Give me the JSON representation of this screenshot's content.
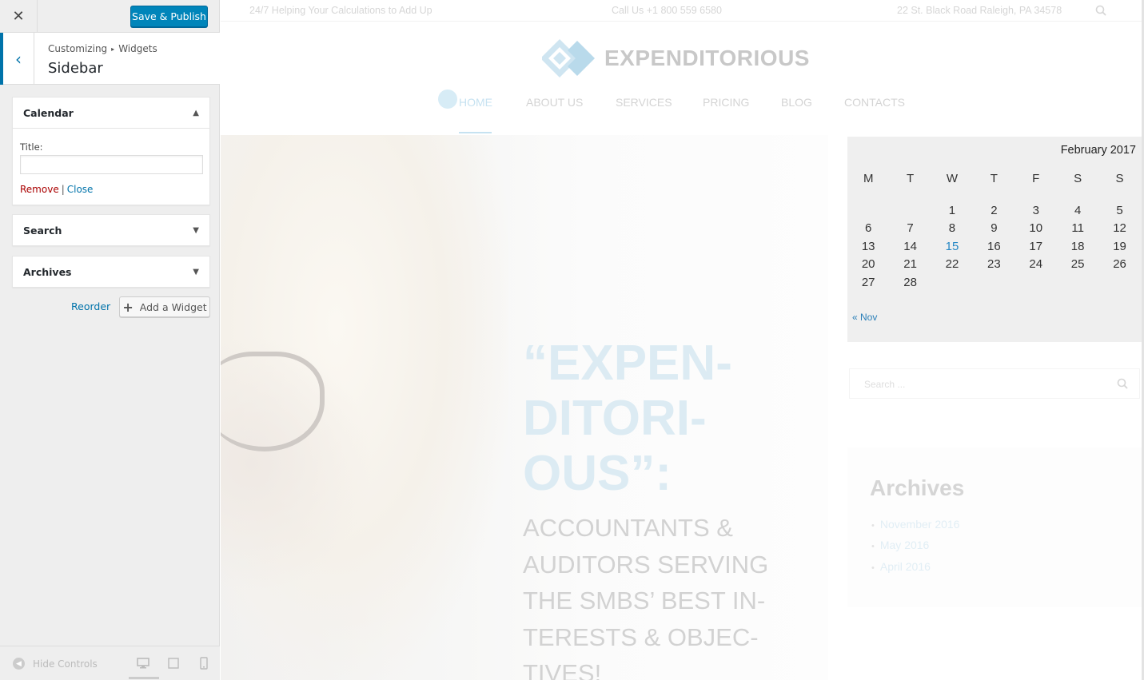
{
  "customizer": {
    "close_icon": "close-icon",
    "save_label": "Save & Publish",
    "breadcrumb": {
      "root": "Customizing",
      "separator": "▸",
      "current": "Widgets"
    },
    "section_title": "Sidebar",
    "widgets": [
      {
        "title": "Calendar",
        "expanded": true,
        "field_label": "Title:",
        "field_value": "",
        "remove_label": "Remove",
        "separator": "|",
        "close_label": "Close"
      },
      {
        "title": "Search",
        "expanded": false
      },
      {
        "title": "Archives",
        "expanded": false
      }
    ],
    "reorder_label": "Reorder",
    "add_widget_label": "Add a Widget",
    "hide_controls_label": "Hide Controls",
    "accent_color": "#0085ba",
    "remove_color": "#aa0000"
  },
  "site": {
    "topbar": {
      "tagline": "24/7 Helping Your Calculations to Add Up",
      "phone": "Call Us +1 800 559 6580",
      "address": "22 St. Black Road Raleigh, PA 34578"
    },
    "logo_text": "EXPENDITORIOUS",
    "nav": [
      "HOME",
      "ABOUT US",
      "SERVICES",
      "PRICING",
      "BLOG",
      "CONTACTS"
    ],
    "hero_title": "“EXPEN-DITORI-OUS”:",
    "hero_subtitle": "ACCOUNTANTS & AUDITORS SERVING THE SMBS’ BEST IN-TERESTS & OBJEC-TIVES!",
    "calendar": {
      "caption": "February 2017",
      "weekdays": [
        "M",
        "T",
        "W",
        "T",
        "F",
        "S",
        "S"
      ],
      "weeks": [
        [
          "",
          "",
          "1",
          "2",
          "3",
          "4",
          "5"
        ],
        [
          "6",
          "7",
          "8",
          "9",
          "10",
          "11",
          "12"
        ],
        [
          "13",
          "14",
          "15",
          "16",
          "17",
          "18",
          "19"
        ],
        [
          "20",
          "21",
          "22",
          "23",
          "24",
          "25",
          "26"
        ],
        [
          "27",
          "28",
          "",
          "",
          "",
          "",
          ""
        ]
      ],
      "today": "15",
      "prev_link": "« Nov"
    },
    "search_placeholder": "Search ...",
    "archives_title": "Archives",
    "archives": [
      "November 2016",
      "May 2016",
      "April 2016"
    ]
  }
}
